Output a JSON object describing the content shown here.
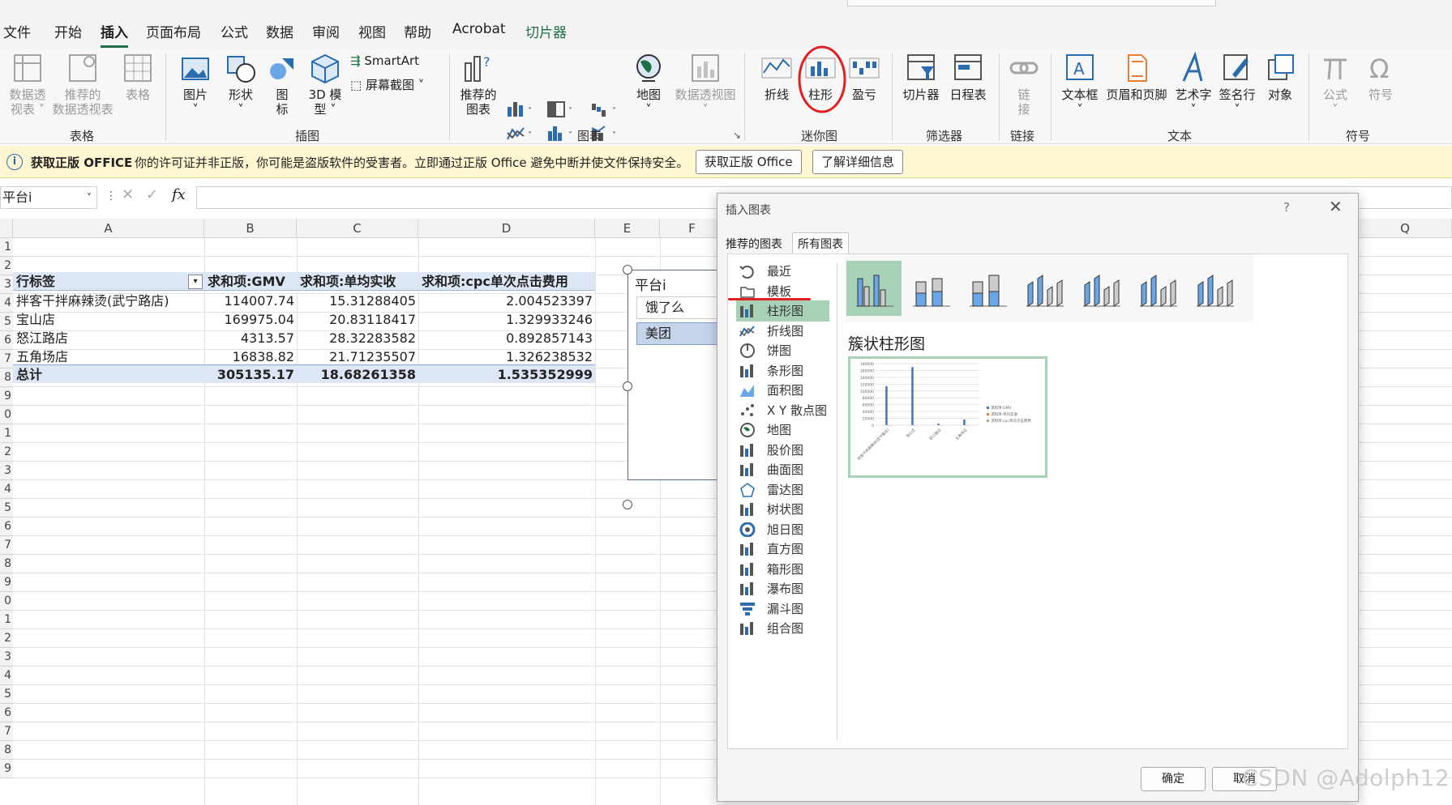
{
  "menu": [
    "文件",
    "开始",
    "插入",
    "页面布局",
    "公式",
    "数据",
    "审阅",
    "视图",
    "帮助",
    "Acrobat",
    "切片器"
  ],
  "ribbon": {
    "tables": {
      "pivot_line1": "数据透",
      "pivot_line2": "视表",
      "recommended_line1": "推荐的",
      "recommended_line2": "数据透视表",
      "table": "表格",
      "group": "表格"
    },
    "illustrations": {
      "picture": "图片",
      "shapes": "形状",
      "icons_line1": "图",
      "icons_line2": "标",
      "model_line1": "3D 模",
      "model_line2": "型",
      "smartart": "SmartArt",
      "screenshot": "屏幕截图",
      "group": "插图"
    },
    "charts": {
      "recommended_line1": "推荐的",
      "recommended_line2": "图表",
      "map": "地图",
      "pivotchart": "数据透视图",
      "group": "图表"
    },
    "sparklines": {
      "line": "折线",
      "column": "柱形",
      "winloss": "盈亏",
      "group": "迷你图"
    },
    "filters": {
      "slicer": "切片器",
      "timeline": "日程表",
      "group": "筛选器"
    },
    "links": {
      "link_line1": "链",
      "link_line2": "接",
      "group": "链接"
    },
    "text": {
      "textbox": "文本框",
      "headerfooter": "页眉和页脚",
      "wordart": "艺术字",
      "signature": "签名行",
      "object": "对象",
      "group": "文本"
    },
    "symbols": {
      "equation": "公式",
      "symbol": "符号",
      "group": "符号"
    }
  },
  "notice": {
    "title": "获取正版 OFFICE",
    "message": "你的许可证并非正版，你可能是盗版软件的受害者。立即通过正版 Office 避免中断并使文件保持安全。",
    "btn_get": "获取正版 Office",
    "btn_learn": "了解详细信息"
  },
  "formula_bar": {
    "name_box": "平台i",
    "fx": "fx",
    "value": ""
  },
  "columns": [
    "A",
    "B",
    "C",
    "D",
    "E",
    "F",
    "Q"
  ],
  "rows": [
    "1",
    "2",
    "3",
    "4",
    "5",
    "6",
    "7",
    "8",
    "9",
    "0",
    "1",
    "2",
    "3",
    "4",
    "5",
    "6",
    "7",
    "8",
    "9",
    "0",
    "1",
    "2",
    "3",
    "4",
    "5",
    "6",
    "7",
    "8",
    "9"
  ],
  "pivot": {
    "headers": [
      "行标签",
      "求和项:GMV",
      "求和项:单均实收",
      "求和项:cpc单次点击费用"
    ],
    "rows": [
      [
        "拌客干拌麻辣烫(武宁路店)",
        "114007.74",
        "15.31288405",
        "2.004523397"
      ],
      [
        "宝山店",
        "169975.04",
        "20.83118417",
        "1.329933246"
      ],
      [
        "怒江路店",
        "4313.57",
        "28.32283582",
        "0.892857143"
      ],
      [
        "五角场店",
        "16838.82",
        "21.71235507",
        "1.326238532"
      ]
    ],
    "total": [
      "总计",
      "305135.17",
      "18.68261358",
      "1.535352999"
    ]
  },
  "slicer": {
    "title": "平台i",
    "items": [
      "饿了么",
      "美团"
    ]
  },
  "dialog": {
    "title": "插入图表",
    "help": "?",
    "tabs": [
      "推荐的图表",
      "所有图表"
    ],
    "categories": [
      "最近",
      "模板",
      "柱形图",
      "折线图",
      "饼图",
      "条形图",
      "面积图",
      "X Y 散点图",
      "地图",
      "股价图",
      "曲面图",
      "雷达图",
      "树状图",
      "旭日图",
      "直方图",
      "箱形图",
      "瀑布图",
      "漏斗图",
      "组合图"
    ],
    "selected_category": "柱形图",
    "subtype_title": "簇状柱形图",
    "ok": "确定",
    "cancel": "取消"
  },
  "preview_chart": {
    "chart_data": {
      "type": "bar",
      "categories": [
        "拌客干拌麻辣烫(武宁路店)",
        "宝山店",
        "怒江路店",
        "五角场店"
      ],
      "series": [
        {
          "name": "求和项:GMV",
          "values": [
            114007.74,
            169975.04,
            4313.57,
            16838.82
          ]
        },
        {
          "name": "求和项:单均实收",
          "values": [
            15.31288405,
            20.83118417,
            28.32283582,
            21.71235507
          ]
        },
        {
          "name": "求和项:cpc单次点击费用",
          "values": [
            2.004523397,
            1.329933246,
            0.892857143,
            1.326238532
          ]
        }
      ],
      "yticks": [
        "180000",
        "160000",
        "140000",
        "120000",
        "100000",
        "80000",
        "60000",
        "40000",
        "20000",
        "0"
      ],
      "ylim": [
        0,
        180000
      ],
      "legend": "right",
      "colors": [
        "#4472c4",
        "#ed7d31",
        "#a5a5a5"
      ]
    }
  },
  "watermark": "CSDN @Adolph12"
}
